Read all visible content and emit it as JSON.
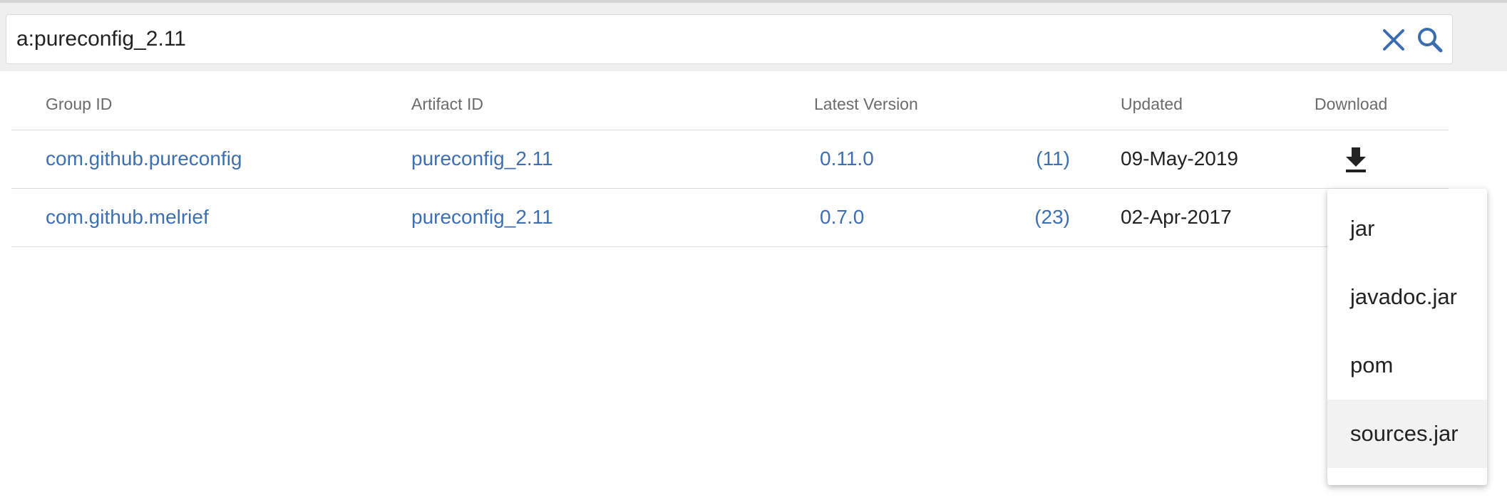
{
  "search": {
    "value": "a:pureconfig_2.11"
  },
  "table": {
    "headers": {
      "group_id": "Group ID",
      "artifact_id": "Artifact ID",
      "latest_version": "Latest Version",
      "updated": "Updated",
      "download": "Download"
    },
    "rows": [
      {
        "group_id": "com.github.pureconfig",
        "artifact_id": "pureconfig_2.11",
        "version": "0.11.0",
        "version_count": "(11)",
        "updated": "09-May-2019"
      },
      {
        "group_id": "com.github.melrief",
        "artifact_id": "pureconfig_2.11",
        "version": "0.7.0",
        "version_count": "(23)",
        "updated": "02-Apr-2017"
      }
    ]
  },
  "download_menu": {
    "items": [
      "jar",
      "javadoc.jar",
      "pom",
      "sources.jar"
    ],
    "highlighted_item": "sources.jar"
  },
  "icons": {
    "clear": "close-icon",
    "search": "search-icon",
    "download": "download-icon"
  },
  "colors": {
    "link": "#3e6fb0",
    "icon": "#3b6eb0",
    "text": "#222222",
    "header_text": "#6b6b6b",
    "menu_highlight": "#f2f2f2"
  }
}
